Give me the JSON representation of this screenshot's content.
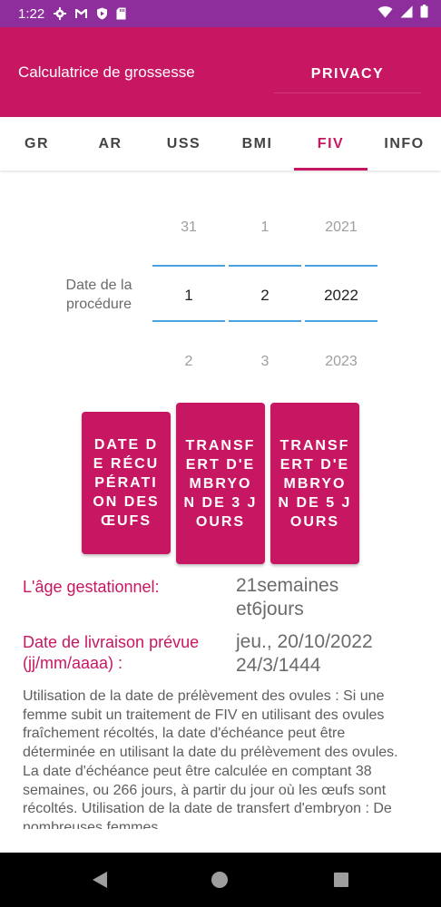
{
  "status_bar": {
    "time": "1:22"
  },
  "app_bar": {
    "title": "Calculatrice de grossesse",
    "privacy_label": "PRIVACY"
  },
  "tabs": [
    {
      "label": "GR"
    },
    {
      "label": "AR"
    },
    {
      "label": "USS"
    },
    {
      "label": "BMI"
    },
    {
      "label": "FIV",
      "active": true
    },
    {
      "label": "INFO"
    }
  ],
  "date_picker": {
    "label": "Date de la procédure",
    "day": {
      "prev": "31",
      "selected": "1",
      "next": "2"
    },
    "month": {
      "prev": "1",
      "selected": "2",
      "next": "3"
    },
    "year": {
      "prev": "2021",
      "selected": "2022",
      "next": "2023"
    }
  },
  "buttons": {
    "egg_retrieval": "DATE DE RÉCUPÉRATION DES ŒUFS",
    "transfer_3": "TRANSFERT D'EMBRYON DE 3 JOURS",
    "transfer_5": "TRANSFERT D'EMBRYON DE 5 JOURS"
  },
  "results": {
    "gestational_label": "L'âge gestationnel:",
    "gestational_value_1": "21semaines",
    "gestational_value_2": "et6jours",
    "due_label_1": "Date de livraison prévue",
    "due_label_2": "(jj/mm/aaaa) :",
    "due_value_1": "jeu., 20/10/2022",
    "due_value_2": "24/3/1444"
  },
  "description": "Utilisation de la date de prélèvement des ovules : Si une femme subit un traitement de FIV en utilisant des ovules fraîchement récoltés, la date d'échéance peut être déterminée en utilisant la date du prélèvement des ovules. La date d'échéance peut être calculée en comptant 38 semaines, ou 266 jours, à partir du jour où les œufs sont récoltés. Utilisation de la date de transfert d'embryon : De nombreuses femmes",
  "colors": {
    "status_bar": "#8e2d9c",
    "accent": "#c81762",
    "picker_line": "#4aa3df"
  }
}
